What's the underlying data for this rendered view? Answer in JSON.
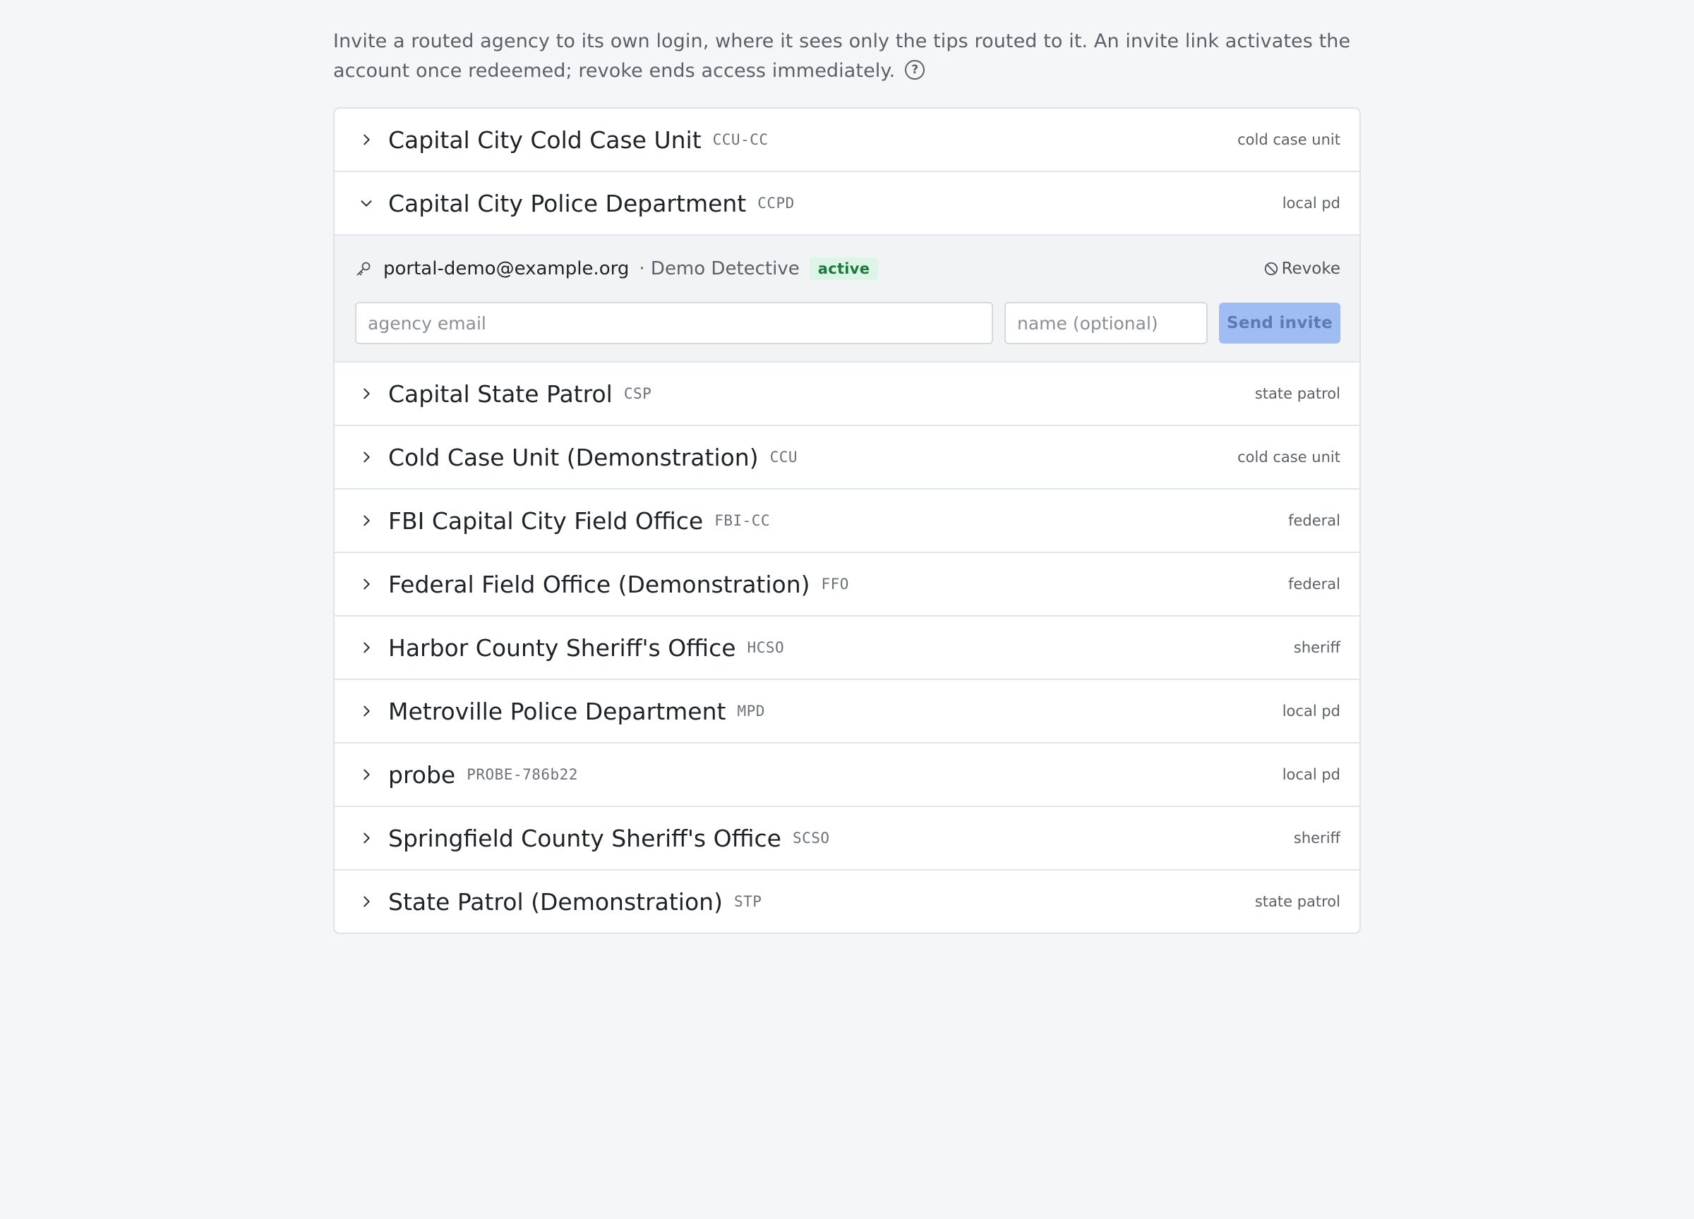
{
  "intro": {
    "text": "Invite a routed agency to its own login, where it sees only the tips routed to it. An invite link activates the account once redeemed; revoke ends access immediately.",
    "help_icon_glyph": "?"
  },
  "agencies": [
    {
      "name": "Capital City Cold Case Unit",
      "code": "CCU-CC",
      "type": "cold case unit",
      "expanded": false
    },
    {
      "name": "Capital City Police Department",
      "code": "CCPD",
      "type": "local pd",
      "expanded": true
    },
    {
      "name": "Capital State Patrol",
      "code": "CSP",
      "type": "state patrol",
      "expanded": false
    },
    {
      "name": "Cold Case Unit (Demonstration)",
      "code": "CCU",
      "type": "cold case unit",
      "expanded": false
    },
    {
      "name": "FBI Capital City Field Office",
      "code": "FBI-CC",
      "type": "federal",
      "expanded": false
    },
    {
      "name": "Federal Field Office (Demonstration)",
      "code": "FFO",
      "type": "federal",
      "expanded": false
    },
    {
      "name": "Harbor County Sheriff's Office",
      "code": "HCSO",
      "type": "sheriff",
      "expanded": false
    },
    {
      "name": "Metroville Police Department",
      "code": "MPD",
      "type": "local pd",
      "expanded": false
    },
    {
      "name": "probe",
      "code": "PROBE-786b22",
      "type": "local pd",
      "expanded": false
    },
    {
      "name": "Springfield County Sheriff's Office",
      "code": "SCSO",
      "type": "sheriff",
      "expanded": false
    },
    {
      "name": "State Patrol (Demonstration)",
      "code": "STP",
      "type": "state patrol",
      "expanded": false
    }
  ],
  "expanded_panel": {
    "account": {
      "email": "portal-demo@example.org",
      "name": "· Demo Detective",
      "status": "active",
      "revoke_label": "Revoke"
    },
    "invite_form": {
      "email_placeholder": "agency email",
      "email_value": "",
      "name_placeholder": "name (optional)",
      "name_value": "",
      "send_label": "Send invite"
    }
  },
  "icons": {
    "row_collapsed": "chevron-right-icon",
    "row_expanded": "chevron-down-icon",
    "account": "key-icon",
    "revoke": "ban-icon",
    "help": "question-circle-icon"
  },
  "colors": {
    "page_bg": "#f5f6f8",
    "status_active_bg": "#ddf5e6",
    "status_active_text": "#1a7a3e",
    "send_button_disabled": "#9fbdf3"
  }
}
